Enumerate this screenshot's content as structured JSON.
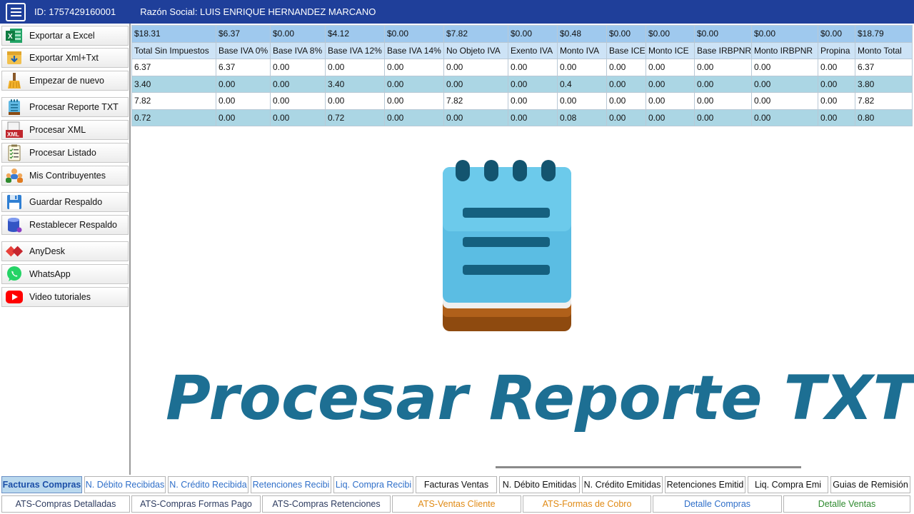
{
  "header": {
    "id_label": "ID: 1757429160001",
    "razon_social": "Razón Social: LUIS ENRIQUE HERNANDEZ MARCANO"
  },
  "sidebar": {
    "items": [
      {
        "label": "Exportar a Excel",
        "icon": "excel-icon"
      },
      {
        "label": "Exportar Xml+Txt",
        "icon": "export-icon"
      },
      {
        "label": "Empezar de nuevo",
        "icon": "broom-icon"
      },
      {
        "label": "Procesar Reporte TXT",
        "icon": "notepad-icon"
      },
      {
        "label": "Procesar XML",
        "icon": "xml-icon"
      },
      {
        "label": "Procesar Listado",
        "icon": "list-icon"
      },
      {
        "label": "Mis Contribuyentes",
        "icon": "people-icon"
      },
      {
        "label": "Guardar Respaldo",
        "icon": "floppy-icon"
      },
      {
        "label": "Restablecer Respaldo",
        "icon": "database-icon"
      },
      {
        "label": "AnyDesk",
        "icon": "anydesk-icon"
      },
      {
        "label": "WhatsApp",
        "icon": "whatsapp-icon"
      },
      {
        "label": "Video tutoriales",
        "icon": "youtube-icon"
      }
    ]
  },
  "grid": {
    "totals": [
      "$18.31",
      "$6.37",
      "$0.00",
      "$4.12",
      "$0.00",
      "$7.82",
      "$0.00",
      "$0.48",
      "$0.00",
      "$0.00",
      "$0.00",
      "$0.00",
      "$0.00",
      "$18.79"
    ],
    "headers": [
      "Total Sin Impuestos",
      "Base IVA 0%",
      "Base IVA 8%",
      "Base IVA 12%",
      "Base IVA 14%",
      "No Objeto IVA",
      "Exento IVA",
      "Monto IVA",
      "Base ICE",
      "Monto ICE",
      "Base IRBPNR",
      "Monto IRBPNR",
      "Propina",
      "Monto Total"
    ],
    "rows": [
      [
        "6.37",
        "6.37",
        "0.00",
        "0.00",
        "0.00",
        "0.00",
        "0.00",
        "0.00",
        "0.00",
        "0.00",
        "0.00",
        "0.00",
        "0.00",
        "6.37"
      ],
      [
        "3.40",
        "0.00",
        "0.00",
        "3.40",
        "0.00",
        "0.00",
        "0.00",
        "0.4",
        "0.00",
        "0.00",
        "0.00",
        "0.00",
        "0.00",
        "3.80"
      ],
      [
        "7.82",
        "0.00",
        "0.00",
        "0.00",
        "0.00",
        "7.82",
        "0.00",
        "0.00",
        "0.00",
        "0.00",
        "0.00",
        "0.00",
        "0.00",
        "7.82"
      ],
      [
        "0.72",
        "0.00",
        "0.00",
        "0.72",
        "0.00",
        "0.00",
        "0.00",
        "0.08",
        "0.00",
        "0.00",
        "0.00",
        "0.00",
        "0.00",
        "0.80"
      ]
    ]
  },
  "overlay_title": "Procesar Reporte TXT",
  "tabs_row1": [
    {
      "label": "Facturas Compras",
      "style": "active"
    },
    {
      "label": "N. Débito Recibidas",
      "style": "blue"
    },
    {
      "label": "N. Crédito Recibida",
      "style": "blue"
    },
    {
      "label": "Retenciones  Recibi",
      "style": "blue"
    },
    {
      "label": "Liq. Compra Recibi",
      "style": "blue"
    },
    {
      "label": "Facturas Ventas",
      "style": "black"
    },
    {
      "label": "N. Débito Emitidas",
      "style": "black"
    },
    {
      "label": "N. Crédito Emitidas",
      "style": "black"
    },
    {
      "label": "Retenciones Emitid",
      "style": "black"
    },
    {
      "label": "Liq. Compra Emi",
      "style": "black"
    },
    {
      "label": "Guias de Remisión",
      "style": "black"
    }
  ],
  "tabs_row2": [
    {
      "label": "ATS-Compras Detalladas",
      "style": "dark"
    },
    {
      "label": "ATS-Compras Formas Pago",
      "style": "dark"
    },
    {
      "label": "ATS-Compras Retenciones",
      "style": "dark"
    },
    {
      "label": "ATS-Ventas Cliente",
      "style": "orange"
    },
    {
      "label": "ATS-Formas de Cobro",
      "style": "orange"
    },
    {
      "label": "Detalle Compras",
      "style": "blue"
    },
    {
      "label": "Detalle Ventas",
      "style": "green"
    }
  ],
  "colors": {
    "titlebar": "#1f3f9a",
    "totals_row": "#9fc9ee",
    "header_row": "#cde3f6",
    "alt_row": "#abd6e4",
    "overlay_title": "#1d6f93"
  }
}
